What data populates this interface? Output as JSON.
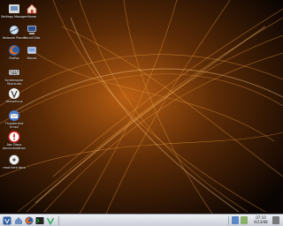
{
  "desktop": {
    "icons": [
      {
        "label": "Settings Manager",
        "icon": "settings-icon"
      },
      {
        "label": "Home",
        "icon": "home-folder-icon"
      },
      {
        "label": "Network Places",
        "icon": "network-icon"
      },
      {
        "label": "Mount Disk",
        "icon": "computer-icon"
      },
      {
        "label": "Firefox",
        "icon": "firefox-icon"
      },
      {
        "label": "Mount",
        "icon": "device-icon"
      },
      {
        "label": "Screensaver Shortcuts",
        "icon": "keyboard-icon"
      },
      {
        "label": "Vectorlinux",
        "icon": "vector-logo-icon"
      },
      {
        "label": "Thunderbird Email",
        "icon": "email-icon"
      },
      {
        "label": "Abc Disco documentation",
        "icon": "help-icon"
      },
      {
        "label": "read here docs",
        "icon": "docs-icon"
      }
    ]
  },
  "taskbar": {
    "launchers": [
      "start-menu-icon",
      "home-icon",
      "firefox-icon",
      "terminal-icon",
      "vector-icon"
    ],
    "workspaces": [
      "1",
      "2",
      "3",
      "4"
    ],
    "clock": {
      "time": "07:10",
      "date": "6/13/08"
    }
  },
  "colors": {
    "wallpaper_base": "#000000",
    "wallpaper_glow": "#e07a1a",
    "taskbar": "#d8dbe2"
  }
}
